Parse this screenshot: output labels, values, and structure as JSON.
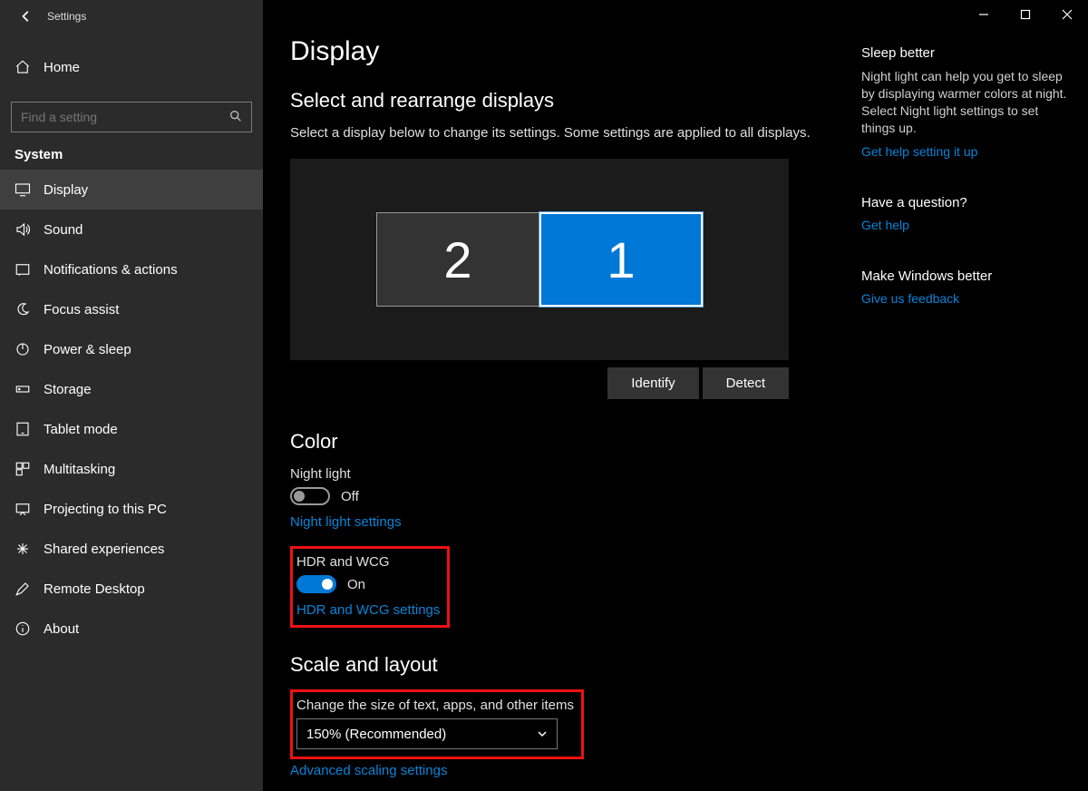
{
  "window": {
    "title": "Settings"
  },
  "sidebar": {
    "home": "Home",
    "search_placeholder": "Find a setting",
    "category": "System",
    "items": [
      {
        "label": "Display"
      },
      {
        "label": "Sound"
      },
      {
        "label": "Notifications & actions"
      },
      {
        "label": "Focus assist"
      },
      {
        "label": "Power & sleep"
      },
      {
        "label": "Storage"
      },
      {
        "label": "Tablet mode"
      },
      {
        "label": "Multitasking"
      },
      {
        "label": "Projecting to this PC"
      },
      {
        "label": "Shared experiences"
      },
      {
        "label": "Remote Desktop"
      },
      {
        "label": "About"
      }
    ]
  },
  "main": {
    "title": "Display",
    "rearrange_heading": "Select and rearrange displays",
    "rearrange_desc": "Select a display below to change its settings. Some settings are applied to all displays.",
    "monitor2_label": "2",
    "monitor1_label": "1",
    "identify_btn": "Identify",
    "detect_btn": "Detect",
    "color_heading": "Color",
    "night_light_label": "Night light",
    "night_light_state": "Off",
    "night_light_settings": "Night light settings",
    "hdr_label": "HDR and WCG",
    "hdr_state": "On",
    "hdr_settings": "HDR and WCG settings",
    "scale_heading": "Scale and layout",
    "scale_label": "Change the size of text, apps, and other items",
    "scale_value": "150% (Recommended)",
    "adv_scaling": "Advanced scaling settings"
  },
  "right": {
    "sleep_heading": "Sleep better",
    "sleep_desc": "Night light can help you get to sleep by displaying warmer colors at night. Select Night light settings to set things up.",
    "sleep_link": "Get help setting it up",
    "question_heading": "Have a question?",
    "question_link": "Get help",
    "better_heading": "Make Windows better",
    "better_link": "Give us feedback"
  }
}
